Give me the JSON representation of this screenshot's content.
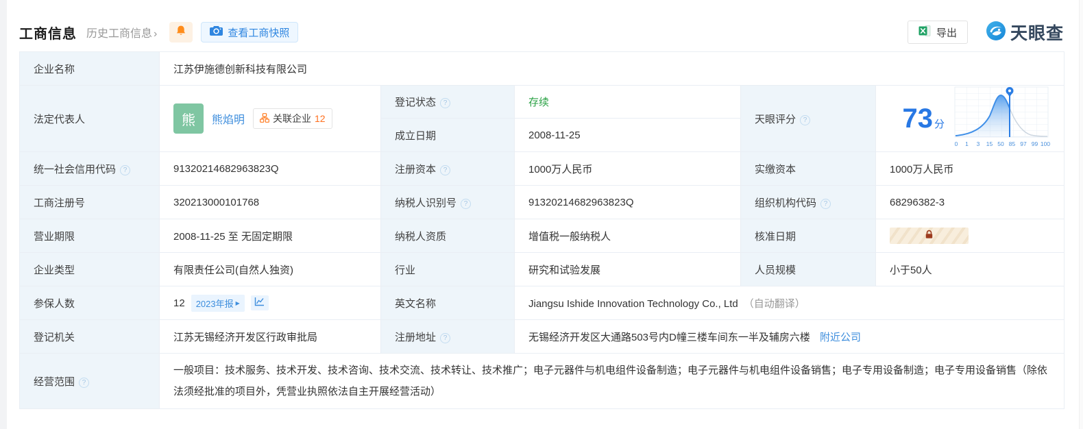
{
  "header": {
    "title": "工商信息",
    "history_link": "历史工商信息",
    "snapshot_button": "查看工商快照",
    "export_button": "导出",
    "brand": "天眼查"
  },
  "icons": {
    "help": "?",
    "chevron_right": "›",
    "triangle_right": "▶"
  },
  "fields": {
    "company_name": {
      "label": "企业名称",
      "value": "江苏伊施德创新科技有限公司"
    },
    "legal_rep": {
      "label": "法定代表人",
      "avatar_char": "熊",
      "name": "熊焰明",
      "related_label": "关联企业",
      "related_count": "12"
    },
    "reg_status": {
      "label": "登记状态",
      "value": "存续"
    },
    "establish_date": {
      "label": "成立日期",
      "value": "2008-11-25"
    },
    "tianyan_score": {
      "label": "天眼评分"
    },
    "credit_code": {
      "label": "统一社会信用代码",
      "value": "91320214682963823Q"
    },
    "reg_capital": {
      "label": "注册资本",
      "value": "1000万人民币"
    },
    "paid_capital": {
      "label": "实缴资本",
      "value": "1000万人民币"
    },
    "reg_number": {
      "label": "工商注册号",
      "value": "320213000101768"
    },
    "taxpayer_id": {
      "label": "纳税人识别号",
      "value": "91320214682963823Q"
    },
    "org_code": {
      "label": "组织机构代码",
      "value": "68296382-3"
    },
    "business_term": {
      "label": "营业期限",
      "value": "2008-11-25 至 无固定期限"
    },
    "taxpayer_quality": {
      "label": "纳税人资质",
      "value": "增值税一般纳税人"
    },
    "approval_date": {
      "label": "核准日期"
    },
    "company_type": {
      "label": "企业类型",
      "value": "有限责任公司(自然人独资)"
    },
    "industry": {
      "label": "行业",
      "value": "研究和试验发展"
    },
    "staff_size": {
      "label": "人员规模",
      "value": "小于50人"
    },
    "insured_count": {
      "label": "参保人数",
      "value": "12",
      "report_badge": "2023年报"
    },
    "english_name": {
      "label": "英文名称",
      "value": "Jiangsu Ishide Innovation Technology Co., Ltd",
      "note": "（自动翻译）"
    },
    "reg_authority": {
      "label": "登记机关",
      "value": "江苏无锡经济开发区行政审批局"
    },
    "reg_address": {
      "label": "注册地址",
      "value": "无锡经济开发区大通路503号内D幢三楼车间东一半及辅房六楼",
      "nearby_link": "附近公司"
    },
    "business_scope": {
      "label": "经营范围",
      "value": "一般项目：技术服务、技术开发、技术咨询、技术交流、技术转让、技术推广；电子元器件与机电组件设备制造；电子元器件与机电组件设备销售；电子专用设备制造；电子专用设备销售（除依法须经批准的项目外，凭营业执照依法自主开展经营活动）"
    }
  },
  "score_chart": {
    "type": "area",
    "score": "73",
    "unit": "分",
    "marker_value": 73,
    "axis": [
      "0",
      "1",
      "3",
      "15",
      "50",
      "85",
      "97",
      "99",
      "100"
    ],
    "curve_shape": "bell-distribution, peak near 50th percentile, filled blue left of marker at 73"
  },
  "colors": {
    "accent_blue": "#2f86e0",
    "link_blue": "#3e8edd",
    "status_green": "#2ba245",
    "orange": "#ff8c1a",
    "label_cell_bg": "#eef5fa",
    "score_blue": "#2878e4",
    "lock_brown": "#9c3a1d"
  }
}
